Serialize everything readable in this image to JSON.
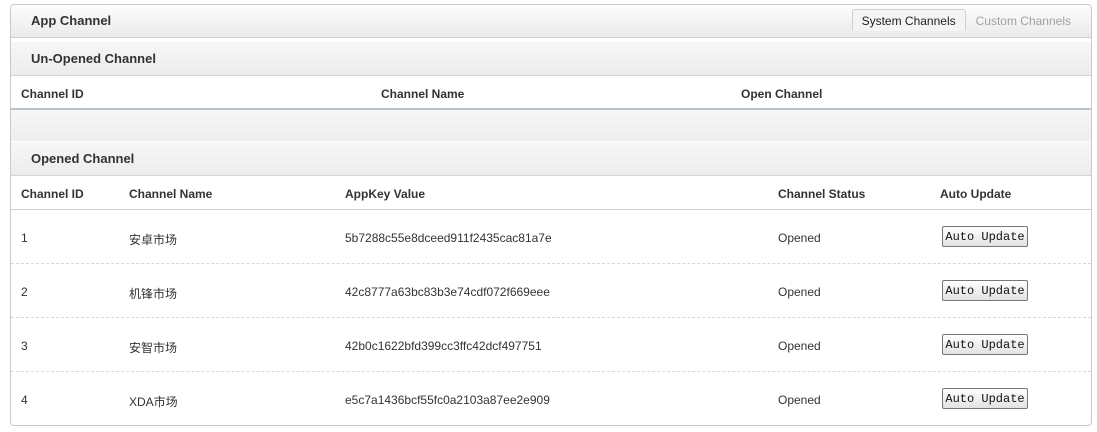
{
  "header": {
    "title": "App Channel",
    "tabs": [
      {
        "label": "System Channels",
        "active": true
      },
      {
        "label": "Custom Channels",
        "active": false
      }
    ]
  },
  "unopened": {
    "title": "Un-Opened Channel",
    "columns": [
      "Channel ID",
      "Channel Name",
      "Open Channel"
    ]
  },
  "opened": {
    "title": "Opened Channel",
    "columns": [
      "Channel ID",
      "Channel Name",
      "AppKey Value",
      "Channel Status",
      "Auto Update"
    ],
    "rows": [
      {
        "id": "1",
        "name": "安卓市场",
        "appkey": "5b7288c55e8dceed911f2435cac81a7e",
        "status": "Opened",
        "button": "Auto Update"
      },
      {
        "id": "2",
        "name": "机锋市场",
        "appkey": "42c8777a63bc83b3e74cdf072f669eee",
        "status": "Opened",
        "button": "Auto Update"
      },
      {
        "id": "3",
        "name": "安智市场",
        "appkey": "42b0c1622bfd399cc3ffc42dcf497751",
        "status": "Opened",
        "button": "Auto Update"
      },
      {
        "id": "4",
        "name": "XDA市场",
        "appkey": "e5c7a1436bcf55fc0a2103a87ee2e909",
        "status": "Opened",
        "button": "Auto Update"
      }
    ]
  }
}
